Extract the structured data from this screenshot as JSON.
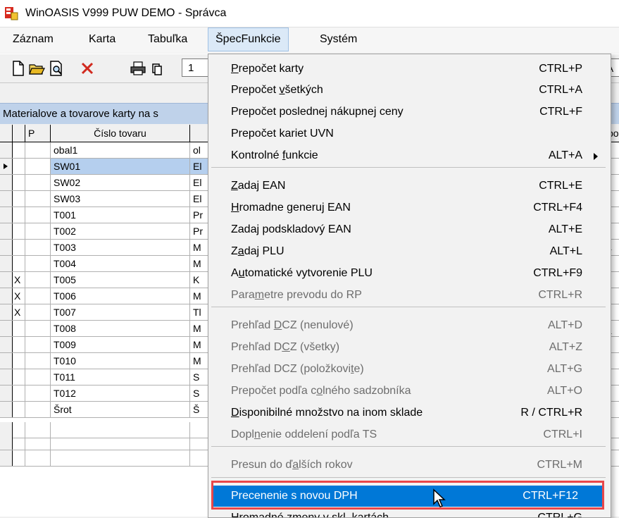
{
  "window": {
    "title": "WinOASIS V999 PUW DEMO - Správca"
  },
  "menubar": {
    "items": [
      "Záznam",
      "Karta",
      "Tabuľka",
      "ŠpecFunkcie",
      "Systém"
    ]
  },
  "toolbar": {
    "page_field": "1",
    "right_field": "LA"
  },
  "panel": {
    "title": "Materialove a tovarove karty na s"
  },
  "grid": {
    "headers": {
      "p": "P",
      "cislo": "Číslo tovaru",
      "right": "spo"
    },
    "rows": [
      {
        "x": "",
        "cislo": "obal1",
        "name": "ol"
      },
      {
        "x": "",
        "cislo": "SW01",
        "name": "El"
      },
      {
        "x": "",
        "cislo": "SW02",
        "name": "El"
      },
      {
        "x": "",
        "cislo": "SW03",
        "name": "El"
      },
      {
        "x": "",
        "cislo": "T001",
        "name": "Pr"
      },
      {
        "x": "",
        "cislo": "T002",
        "name": "Pr"
      },
      {
        "x": "",
        "cislo": "T003",
        "name": "M"
      },
      {
        "x": "",
        "cislo": "T004",
        "name": "M"
      },
      {
        "x": "X",
        "cislo": "T005",
        "name": "K"
      },
      {
        "x": "X",
        "cislo": "T006",
        "name": "M"
      },
      {
        "x": "X",
        "cislo": "T007",
        "name": "Tl"
      },
      {
        "x": "",
        "cislo": "T008",
        "name": "M"
      },
      {
        "x": "",
        "cislo": "T009",
        "name": "M"
      },
      {
        "x": "",
        "cislo": "T010",
        "name": "M"
      },
      {
        "x": "",
        "cislo": "T011",
        "name": "S"
      },
      {
        "x": "",
        "cislo": "T012",
        "name": "S"
      },
      {
        "x": "",
        "cislo": "Šrot",
        "name": "Š"
      }
    ]
  },
  "dropdown": {
    "items": [
      {
        "pre": "",
        "u": "P",
        "post": "repočet karty",
        "shortcut": "CTRL+P"
      },
      {
        "pre": "Prepočet ",
        "u": "v",
        "post": "šetkých",
        "shortcut": "CTRL+A"
      },
      {
        "pre": "Prepočet poslednej nákupnej ceny",
        "u": "",
        "post": "",
        "shortcut": "CTRL+F"
      },
      {
        "pre": "Prepočet kariet UVN",
        "u": "",
        "post": "",
        "shortcut": ""
      },
      {
        "pre": "Kontrolné ",
        "u": "f",
        "post": "unkcie",
        "shortcut": "ALT+A"
      },
      {
        "pre": "",
        "u": "Z",
        "post": "adaj EAN",
        "shortcut": "CTRL+E"
      },
      {
        "pre": "",
        "u": "H",
        "post": "romadne generuj  EAN",
        "shortcut": "CTRL+F4"
      },
      {
        "pre": "Zadaj podskladový EAN",
        "u": "",
        "post": "",
        "shortcut": "ALT+E"
      },
      {
        "pre": "Z",
        "u": "a",
        "post": "daj PLU",
        "shortcut": "ALT+L"
      },
      {
        "pre": "A",
        "u": "u",
        "post": "tomatické vytvorenie PLU",
        "shortcut": "CTRL+F9"
      },
      {
        "pre": "Para",
        "u": "m",
        "post": "etre prevodu do RP",
        "shortcut": "CTRL+R"
      },
      {
        "pre": "Prehľad ",
        "u": "D",
        "post": "CZ (nenulové)",
        "shortcut": "ALT+D"
      },
      {
        "pre": "Prehľad D",
        "u": "C",
        "post": "Z (všetky)",
        "shortcut": "ALT+Z"
      },
      {
        "pre": "Prehľad DCZ (položkovi",
        "u": "t",
        "post": "e)",
        "shortcut": "ALT+G"
      },
      {
        "pre": "Prepočet podľa c",
        "u": "o",
        "post": "lného sadzobníka",
        "shortcut": "ALT+O"
      },
      {
        "pre": "",
        "u": "D",
        "post": "isponibilné množstvo na inom sklade",
        "shortcut": "R / CTRL+R"
      },
      {
        "pre": "Dopl",
        "u": "n",
        "post": "enie oddelení podľa TS",
        "shortcut": "CTRL+I"
      },
      {
        "pre": "Presun do ď",
        "u": "a",
        "post": "lších rokov",
        "shortcut": "CTRL+M"
      },
      {
        "pre": "Precenenie s novou DPH",
        "u": "",
        "post": "",
        "shortcut": "CTRL+F12"
      },
      {
        "pre": "Hromadné zmeny v skl. kartách",
        "u": "",
        "post": "",
        "shortcut": "CTRL+G"
      }
    ]
  }
}
